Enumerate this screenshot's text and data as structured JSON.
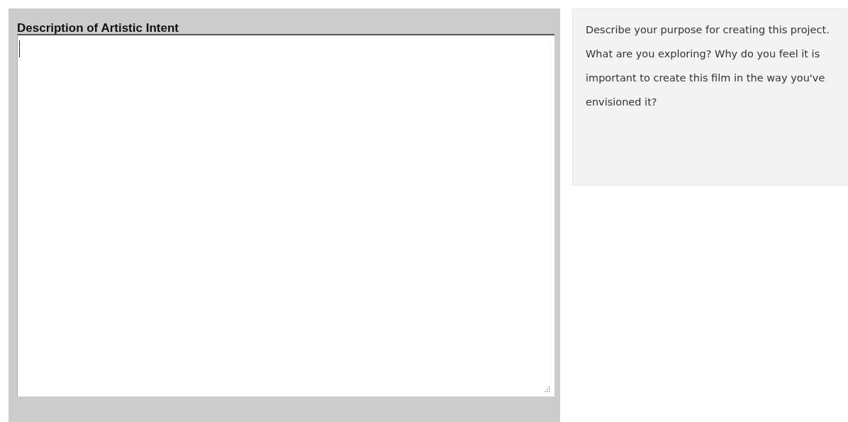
{
  "field": {
    "label": "Description of Artistic Intent",
    "focused": true
  },
  "help": {
    "text": "Describe your purpose for creating this project. What are you exploring? Why do you feel it is important to create this film in the way you've envisioned it?"
  }
}
